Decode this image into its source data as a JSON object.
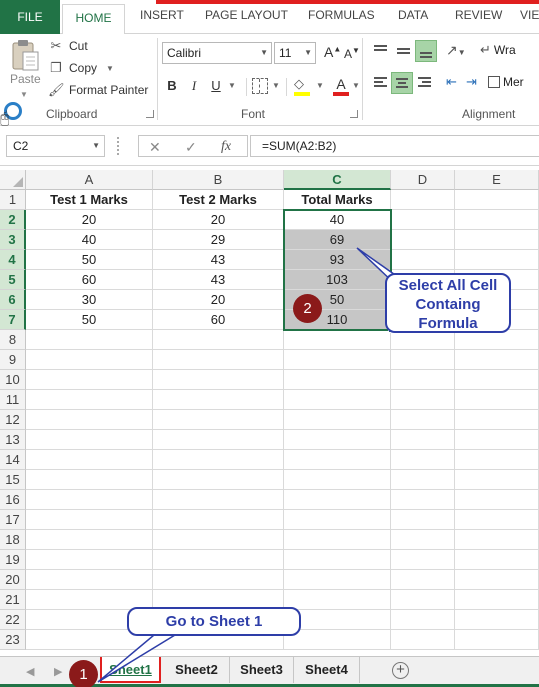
{
  "ribbon": {
    "file_tab": "FILE",
    "tabs": [
      "HOME",
      "INSERT",
      "PAGE LAYOUT",
      "FORMULAS",
      "DATA",
      "REVIEW",
      "VIE"
    ],
    "clipboard": {
      "paste": "Paste",
      "cut": "Cut",
      "copy": "Copy",
      "format_painter": "Format Painter",
      "group_label": "Clipboard"
    },
    "font": {
      "name": "Calibri",
      "size": "11",
      "bold": "B",
      "italic": "I",
      "underline": "U",
      "grow": "A",
      "shrink": "A",
      "font_color_letter": "A",
      "group_label": "Font"
    },
    "alignment": {
      "wrap": "Wra",
      "merge": "Mer",
      "group_label": "Alignment"
    }
  },
  "formula_bar": {
    "name_box": "C2",
    "cancel": "✕",
    "enter": "✓",
    "fx": "fx",
    "formula": "=SUM(A2:B2)"
  },
  "grid": {
    "columns": [
      "A",
      "B",
      "C",
      "D",
      "E"
    ],
    "rows": [
      "1",
      "2",
      "3",
      "4",
      "5",
      "6",
      "7",
      "8",
      "9",
      "10",
      "11",
      "12",
      "13",
      "14",
      "15",
      "16",
      "17",
      "18",
      "19",
      "20",
      "21",
      "22",
      "23"
    ],
    "header_row": [
      "Test 1 Marks",
      "Test 2 Marks",
      "Total Marks"
    ],
    "data": [
      [
        "20",
        "20",
        "40"
      ],
      [
        "40",
        "29",
        "69"
      ],
      [
        "50",
        "43",
        "93"
      ],
      [
        "60",
        "43",
        "103"
      ],
      [
        "30",
        "20",
        "50"
      ],
      [
        "50",
        "60",
        "110"
      ]
    ]
  },
  "sheets": {
    "tabs": [
      "Sheet1",
      "Sheet2",
      "Sheet3",
      "Sheet4"
    ],
    "active": "Sheet1",
    "add": "+"
  },
  "annotations": {
    "badge_1": "1",
    "badge_2": "2",
    "callout_select": "Select All Cell Containg Formula",
    "callout_sheet": "Go to Sheet 1"
  },
  "colors": {
    "excel_green": "#217346",
    "selection_fill": "#c6c6c6",
    "annotation_blue": "#2e3ea8",
    "badge_red": "#8b1a1a",
    "highlight_red": "#e0201f"
  }
}
